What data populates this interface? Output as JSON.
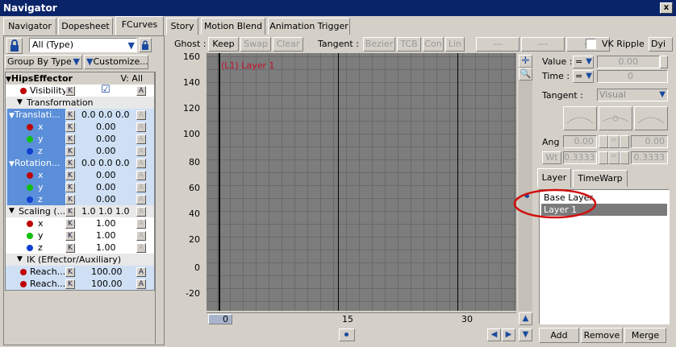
{
  "window": {
    "title": "Navigator",
    "close": "x"
  },
  "tabs": [
    "Navigator",
    "Dopesheet",
    "FCurves",
    "Story",
    "Motion Blend",
    "Animation Trigger"
  ],
  "active_tab": "FCurves",
  "left": {
    "filter": "All (Type)",
    "group_by": "Group By Type",
    "customize": "Customize...",
    "root": "HipsEffector",
    "v_all": "V: All",
    "visibility": "Visibility",
    "transformation": "Transformation",
    "translation": "Translati...",
    "translation_vals": "0.0 0.0 0.0",
    "rotation": "Rotation...",
    "rotation_vals": "0.0 0.0 0.0",
    "scaling": "Scaling (...",
    "scaling_vals": "1.0 1.0 1.0",
    "ik": "IK (Effector/Auxiliary)",
    "x": "x",
    "y": "y",
    "z": "z",
    "zero": "0.00",
    "one": "1.00",
    "reach1": "Reach...",
    "reach2": "Reach...",
    "reach_val": "100.00",
    "k": "K",
    "a": "A"
  },
  "toolbar": {
    "ghost": "Ghost :",
    "keep": "Keep",
    "swap": "Swap",
    "clear": "Clear",
    "tangent": "Tangent :",
    "bezier": "Bezier",
    "tcb": "TCB",
    "con": "Con",
    "lin": "Lin",
    "dash1": "---",
    "dash2": "---",
    "dash3": "---",
    "vk_ripple": "VK Ripple",
    "dy": "Dyi"
  },
  "graph": {
    "curve_label": "(L1) Layer  1",
    "y_ticks": [
      "160",
      "140",
      "120",
      "100",
      "80",
      "60",
      "40",
      "20",
      "0",
      "-20"
    ],
    "x_ticks": [
      "0",
      "15",
      "30"
    ]
  },
  "props": {
    "value": "Value :",
    "time": "Time :",
    "eq": "=",
    "value_val": "0.00",
    "time_val": "0",
    "tangent": "Tangent :",
    "tangent_val": "Visual",
    "ang": "Ang",
    "wt": "Wt",
    "ang_l": "0.00",
    "ang_r": "0.00",
    "wt_l": "0.3333",
    "wt_r": "0.3333"
  },
  "layer_tabs": [
    "Layer",
    "TimeWarp"
  ],
  "layers": [
    "Base Layer",
    "Layer  1"
  ],
  "layer_buttons": [
    "Add",
    "Remove",
    "Merge"
  ],
  "colors": {
    "accent": "#0a246a",
    "selected_row": "#cfe0f5",
    "highlight": "#5b8fd9",
    "annotation": "#d01010"
  }
}
